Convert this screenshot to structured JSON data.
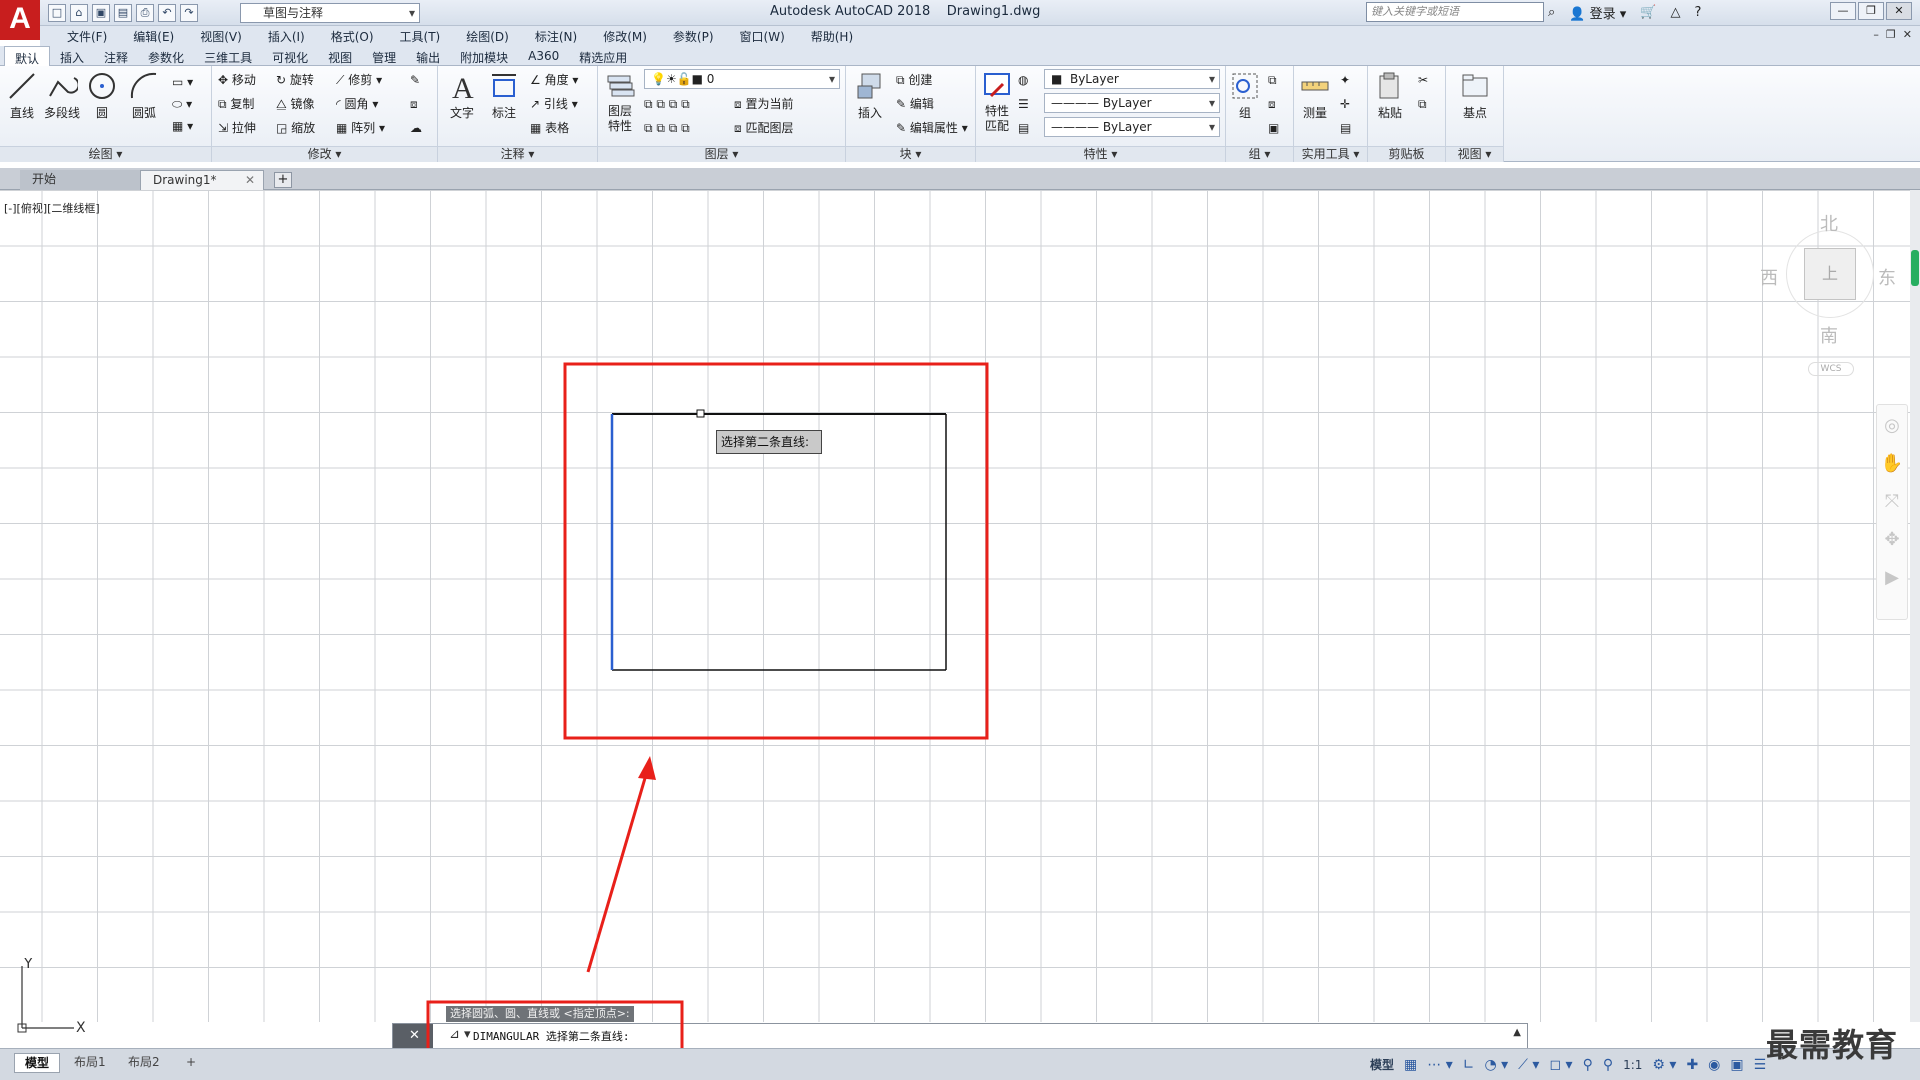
{
  "window": {
    "app_title": "Autodesk AutoCAD 2018",
    "file_name": "Drawing1.dwg",
    "workspace": "草图与注释",
    "search_placeholder": "键入关键字或短语",
    "login": "登录",
    "help": "?"
  },
  "menu": [
    "文件(F)",
    "编辑(E)",
    "视图(V)",
    "插入(I)",
    "格式(O)",
    "工具(T)",
    "绘图(D)",
    "标注(N)",
    "修改(M)",
    "参数(P)",
    "窗口(W)",
    "帮助(H)"
  ],
  "ribbon_tabs": [
    "默认",
    "插入",
    "注释",
    "参数化",
    "三维工具",
    "可视化",
    "视图",
    "管理",
    "输出",
    "附加模块",
    "A360",
    "精选应用"
  ],
  "ribbon": {
    "draw": {
      "title": "绘图",
      "line": "直线",
      "polyline": "多段线",
      "circle": "圆",
      "arc": "圆弧"
    },
    "modify": {
      "title": "修改",
      "move": "移动",
      "rotate": "旋转",
      "trim": "修剪",
      "copy": "复制",
      "mirror": "镜像",
      "fillet": "圆角",
      "stretch": "拉伸",
      "scale": "缩放",
      "array": "阵列"
    },
    "annotation": {
      "title": "注释",
      "text": "文字",
      "dimension": "标注",
      "angle": "角度",
      "leader": "引线",
      "table": "表格"
    },
    "layers": {
      "title": "图层",
      "properties": "图层\n特性",
      "current_layer": "0",
      "make_current": "置为当前",
      "match_layer": "匹配图层"
    },
    "block": {
      "title": "块",
      "insert": "插入",
      "create": "创建",
      "edit": "编辑",
      "edit_attributes": "编辑属性"
    },
    "properties": {
      "title": "特性",
      "match": "特性\n匹配",
      "color": "ByLayer",
      "linetype": "ByLayer",
      "lineweight": "ByLayer"
    },
    "groups": {
      "title": "组",
      "group": "组"
    },
    "utilities": {
      "title": "实用工具",
      "measure": "测量"
    },
    "clipboard": {
      "title": "剪贴板",
      "paste": "粘贴"
    },
    "view": {
      "title": "视图",
      "base": "基点"
    }
  },
  "doc_tabs": {
    "start": "开始",
    "active": "Drawing1*"
  },
  "viewport_label": "[-][俯视][二维线框]",
  "viewcube": {
    "north": "北",
    "south": "南",
    "east": "东",
    "west": "西",
    "face": "上",
    "wcs": "WCS"
  },
  "tooltip": "选择第二条直线:",
  "ucs": {
    "x": "X",
    "y": "Y"
  },
  "command": {
    "history": "选择圆弧、圆、直线或 <指定顶点>:",
    "prompt": "DIMANGULAR 选择第二条直线:"
  },
  "layout_tabs": [
    "模型",
    "布局1",
    "布局2"
  ],
  "status": {
    "model": "模型",
    "scale": "1:1"
  },
  "watermark": "最需教育",
  "colors": {
    "accent": "#c81e1e",
    "highlight_box": "#e8201a",
    "selected_line": "#2a5fd0"
  }
}
